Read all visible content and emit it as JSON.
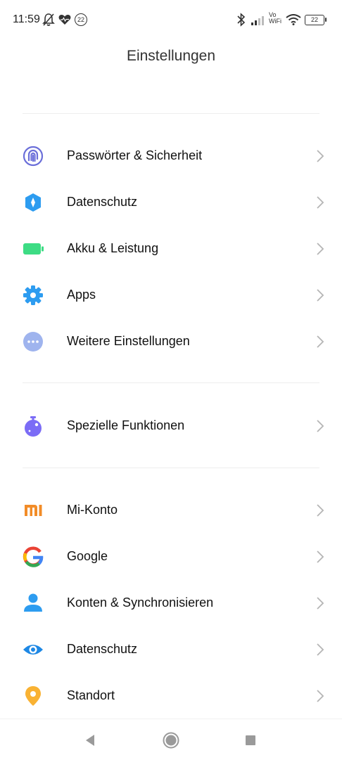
{
  "status_bar": {
    "time": "11:59",
    "notification_badge": "22",
    "volte_top": "Vo",
    "volte_bottom": "WiFi",
    "battery_level": "22",
    "icons": [
      "bell-muted-icon",
      "heart-icon",
      "notification-count-icon",
      "bluetooth-icon",
      "signal-icon",
      "vowifi-icon",
      "wifi-icon",
      "battery-icon"
    ]
  },
  "header": {
    "title": "Einstellungen"
  },
  "groups": [
    [
      {
        "label": "Passwörter & Sicherheit",
        "icon": "fingerprint-icon",
        "color": "#6B6FD9"
      },
      {
        "label": "Datenschutz",
        "icon": "privacy-shield-icon",
        "color": "#2D9CF0"
      },
      {
        "label": "Akku & Leistung",
        "icon": "battery-icon",
        "color": "#3DDC84"
      },
      {
        "label": "Apps",
        "icon": "gear-icon",
        "color": "#2D9CF0"
      },
      {
        "label": "Weitere Einstellungen",
        "icon": "more-dots-icon",
        "color": "#9FB4EE"
      }
    ],
    [
      {
        "label": "Spezielle Funktionen",
        "icon": "special-features-icon",
        "color": "#7B6CF6"
      }
    ],
    [
      {
        "label": "Mi-Konto",
        "icon": "mi-logo-icon",
        "color": "#F28C28"
      },
      {
        "label": "Google",
        "icon": "google-logo-icon",
        "color": "#4285F4"
      },
      {
        "label": "Konten & Synchronisieren",
        "icon": "account-icon",
        "color": "#2D9CF0"
      },
      {
        "label": "Datenschutz",
        "icon": "eye-icon",
        "color": "#1E88E5"
      },
      {
        "label": "Standort",
        "icon": "location-pin-icon",
        "color": "#F9B233"
      }
    ]
  ],
  "nav_bar": {
    "buttons": [
      "back-icon",
      "home-icon",
      "recents-icon"
    ]
  }
}
